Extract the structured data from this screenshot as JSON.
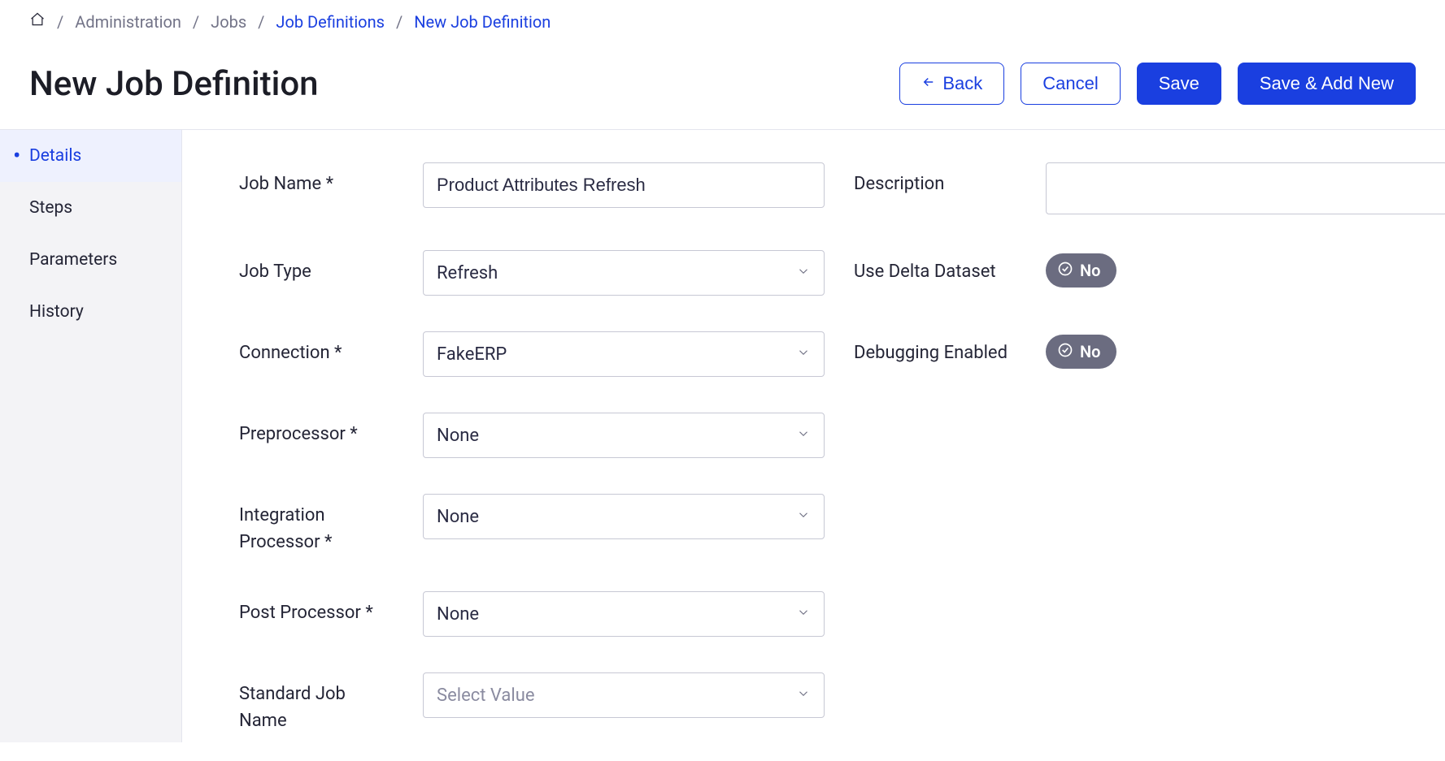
{
  "breadcrumbs": {
    "administration": "Administration",
    "jobs": "Jobs",
    "job_definitions": "Job Definitions",
    "new_job_definition": "New Job Definition"
  },
  "header": {
    "title": "New Job Definition",
    "back": "Back",
    "cancel": "Cancel",
    "save": "Save",
    "save_add_new": "Save & Add New"
  },
  "sidebar": {
    "details": "Details",
    "steps": "Steps",
    "parameters": "Parameters",
    "history": "History"
  },
  "form": {
    "job_name_label": "Job Name",
    "job_name_value": "Product Attributes Refresh",
    "job_type_label": "Job Type",
    "job_type_value": "Refresh",
    "connection_label": "Connection",
    "connection_value": "FakeERP",
    "preprocessor_label": "Preprocessor",
    "preprocessor_value": "None",
    "integration_processor_label": "Integration Processor",
    "integration_processor_value": "None",
    "post_processor_label": "Post Processor",
    "post_processor_value": "None",
    "standard_job_name_label": "Standard Job Name",
    "standard_job_name_placeholder": "Select Value",
    "description_label": "Description",
    "description_value": "",
    "use_delta_dataset_label": "Use Delta Dataset",
    "use_delta_dataset_value": "No",
    "debugging_enabled_label": "Debugging Enabled",
    "debugging_enabled_value": "No"
  }
}
